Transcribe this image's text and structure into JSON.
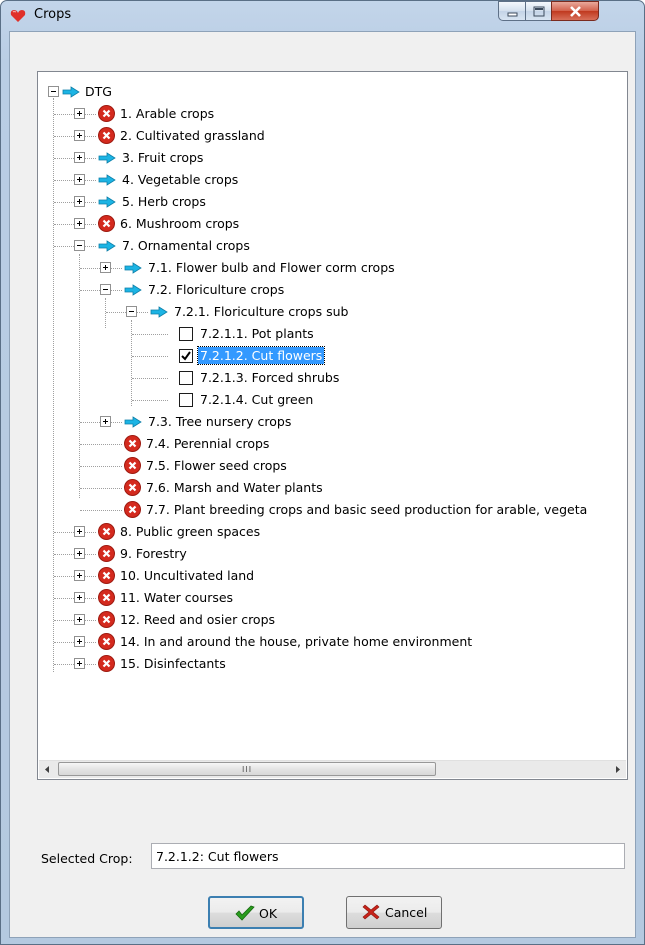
{
  "window": {
    "title": "Crops"
  },
  "tree": {
    "root": "DTG",
    "n1": "1.  Arable crops",
    "n2": "2. Cultivated grassland",
    "n3": "3.  Fruit crops",
    "n4": "4. Vegetable crops",
    "n5": "5. Herb crops",
    "n6": "6. Mushroom crops",
    "n7": "7.  Ornamental crops",
    "n71": "7.1. Flower bulb and Flower corm crops",
    "n72": "7.2. Floriculture crops",
    "n721": "7.2.1. Floriculture crops sub",
    "n7211": "7.2.1.1. Pot plants",
    "n7212": "7.2.1.2. Cut flowers",
    "n7213": "7.2.1.3. Forced shrubs",
    "n7214": "7.2.1.4. Cut green",
    "n73": "7.3. Tree nursery crops",
    "n74": "7.4. Perennial crops",
    "n75": "7.5. Flower seed crops",
    "n76": "7.6. Marsh and Water plants",
    "n77": "7.7. Plant breeding crops and basic seed production for arable, vegeta",
    "n8": "8. Public green spaces",
    "n9": "9. Forestry",
    "n10": "10. Uncultivated land",
    "n11": "11. Water courses",
    "n12": "12. Reed and osier crops",
    "n14": "14. In and around the house, private home environment",
    "n15": "15. Disinfectants"
  },
  "scrollbar": {
    "grip": "III"
  },
  "selected": {
    "label": "Selected Crop:",
    "value": "7.2.1.2: Cut flowers"
  },
  "buttons": {
    "ok": "OK",
    "cancel": "Cancel"
  },
  "colors": {
    "arrow": "#1cb4e4",
    "x_icon": "#d42a1e",
    "selection": "#3399ff",
    "titlebar": "#c3d5ea"
  }
}
